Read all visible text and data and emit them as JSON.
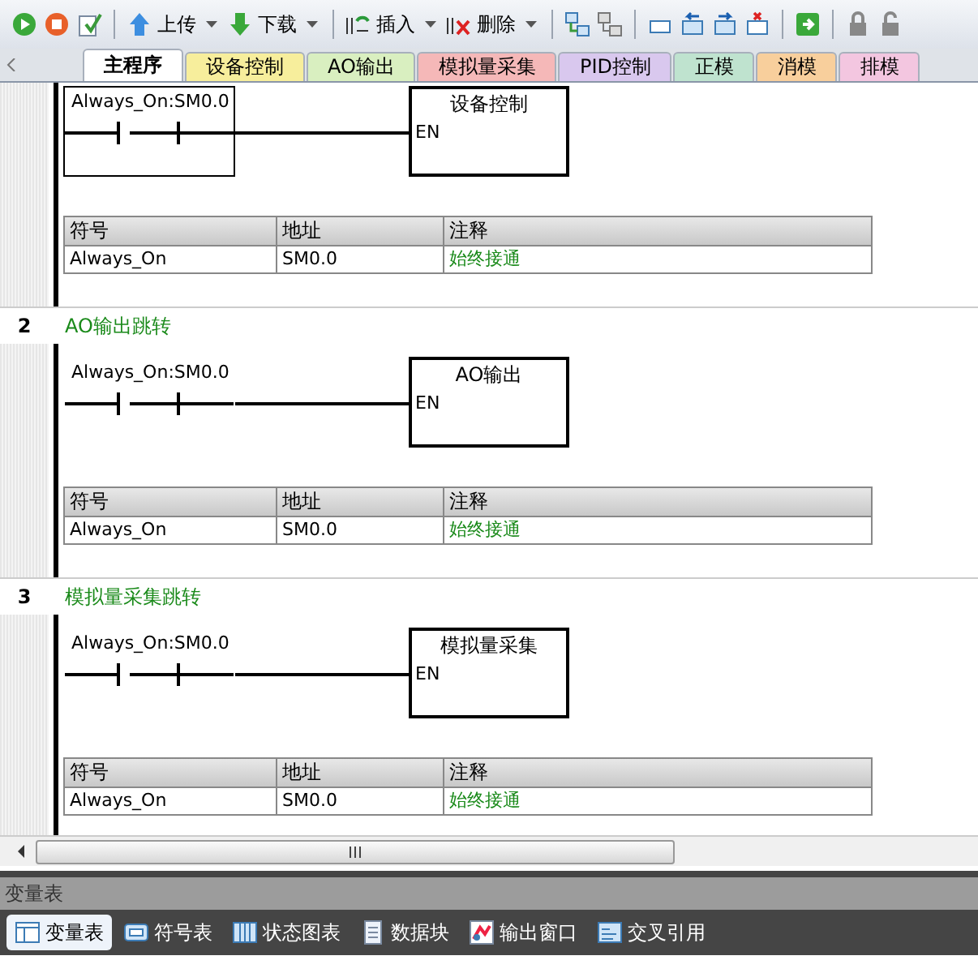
{
  "toolbar": {
    "upload": {
      "label": "上传"
    },
    "download": {
      "label": "下载"
    },
    "insert": {
      "label": "插入"
    },
    "delete": {
      "label": "删除"
    }
  },
  "tabs": [
    {
      "label": "主程序",
      "color": "#ffffff",
      "selected": true
    },
    {
      "label": "设备控制",
      "color": "#f7ee9c",
      "selected": false
    },
    {
      "label": "AO输出",
      "color": "#d9efc0",
      "selected": false
    },
    {
      "label": "模拟量采集",
      "color": "#f5b8b8",
      "selected": false
    },
    {
      "label": "PID控制",
      "color": "#d9c8ee",
      "selected": false
    },
    {
      "label": "正模",
      "color": "#bfe3cf",
      "selected": false
    },
    {
      "label": "消模",
      "color": "#f8cf9c",
      "selected": false
    },
    {
      "label": "排模",
      "color": "#f3c6e0",
      "selected": false
    }
  ],
  "networks": [
    {
      "contact": {
        "label": "Always_On:SM0.0",
        "selected": true
      },
      "box": {
        "title": "设备控制",
        "input": "EN"
      },
      "symbols": {
        "columns": [
          "符号",
          "地址",
          "注释"
        ],
        "rows": [
          [
            "Always_On",
            "SM0.0",
            "始终接通"
          ]
        ]
      }
    },
    {
      "number": "2",
      "title": "AO输出跳转",
      "contact": {
        "label": "Always_On:SM0.0",
        "selected": false
      },
      "box": {
        "title": "AO输出",
        "input": "EN"
      },
      "symbols": {
        "columns": [
          "符号",
          "地址",
          "注释"
        ],
        "rows": [
          [
            "Always_On",
            "SM0.0",
            "始终接通"
          ]
        ]
      }
    },
    {
      "number": "3",
      "title": "模拟量采集跳转",
      "contact": {
        "label": "Always_On:SM0.0",
        "selected": false
      },
      "box": {
        "title": "模拟量采集",
        "input": "EN"
      },
      "symbols": {
        "columns": [
          "符号",
          "地址",
          "注释"
        ],
        "rows": [
          [
            "Always_On",
            "SM0.0",
            "始终接通"
          ]
        ]
      }
    }
  ],
  "panel": {
    "title": "变量表"
  },
  "bottom_tabs": [
    {
      "label": "变量表",
      "selected": true
    },
    {
      "label": "符号表",
      "selected": false
    },
    {
      "label": "状态图表",
      "selected": false
    },
    {
      "label": "数据块",
      "selected": false
    },
    {
      "label": "输出窗口",
      "selected": false
    },
    {
      "label": "交叉引用",
      "selected": false
    }
  ]
}
